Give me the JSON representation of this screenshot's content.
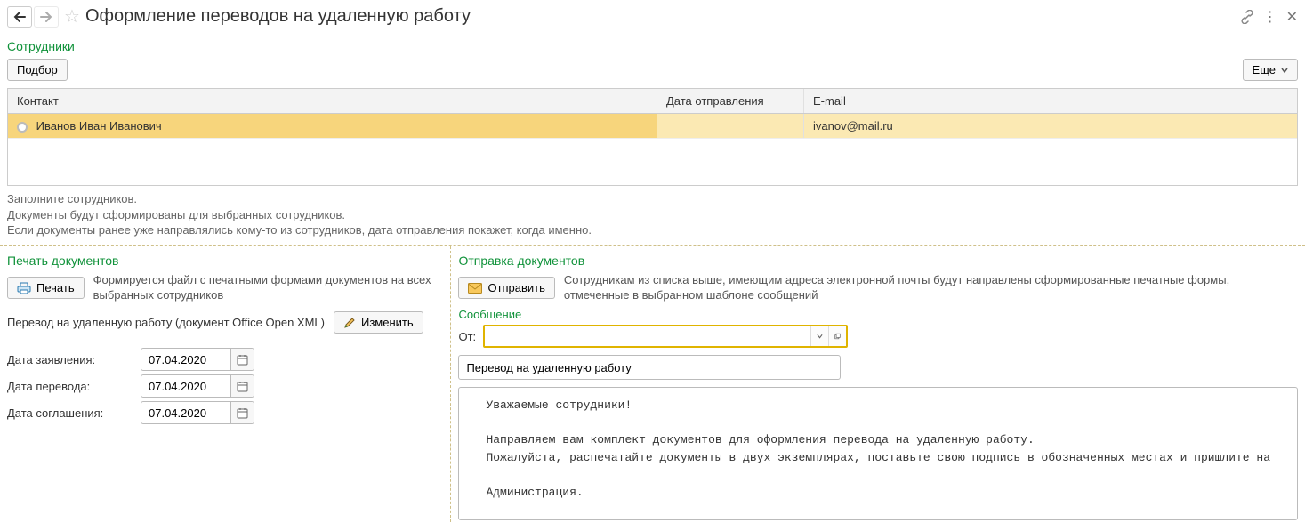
{
  "title": "Оформление переводов на удаленную работу",
  "employees_heading": "Сотрудники",
  "select_btn": "Подбор",
  "more_btn": "Еще",
  "table": {
    "headers": {
      "contact": "Контакт",
      "date": "Дата отправления",
      "email": "E-mail"
    },
    "rows": [
      {
        "contact": "Иванов Иван Иванович",
        "date": "",
        "email": "ivanov@mail.ru"
      }
    ]
  },
  "hints": {
    "line1": "Заполните сотрудников.",
    "line2": "Документы будут сформированы для выбранных сотрудников.",
    "line3": "Если документы ранее уже направлялись кому-то из сотрудников, дата отправления покажет, когда именно."
  },
  "print_section": {
    "heading": "Печать документов",
    "print_btn": "Печать",
    "hint": "Формируется файл с печатными формами документов на всех выбранных сотрудников",
    "template_label": "Перевод на удаленную работу (документ Office Open XML)",
    "change_btn": "Изменить",
    "date_application_label": "Дата заявления:",
    "date_transfer_label": "Дата перевода:",
    "date_agreement_label": "Дата соглашения:",
    "date_application": "07.04.2020",
    "date_transfer": "07.04.2020",
    "date_agreement": "07.04.2020"
  },
  "send_section": {
    "heading": "Отправка документов",
    "send_btn": "Отправить",
    "hint": "Сотрудникам из списка выше, имеющим адреса электронной почты будут направлены сформированные печатные формы, отмеченные в выбранном шаблоне сообщений",
    "message_heading": "Сообщение",
    "from_label": "От:",
    "from_value": "",
    "subject": "Перевод на удаленную работу",
    "body": "Уважаемые сотрудники!\n\nНаправляем вам комплект документов для оформления перевода на удаленную работу.\nПожалуйста, распечатайте документы в двух экземплярах, поставьте свою подпись в обозначенных местах и пришлите на\n\nАдминистрация."
  }
}
